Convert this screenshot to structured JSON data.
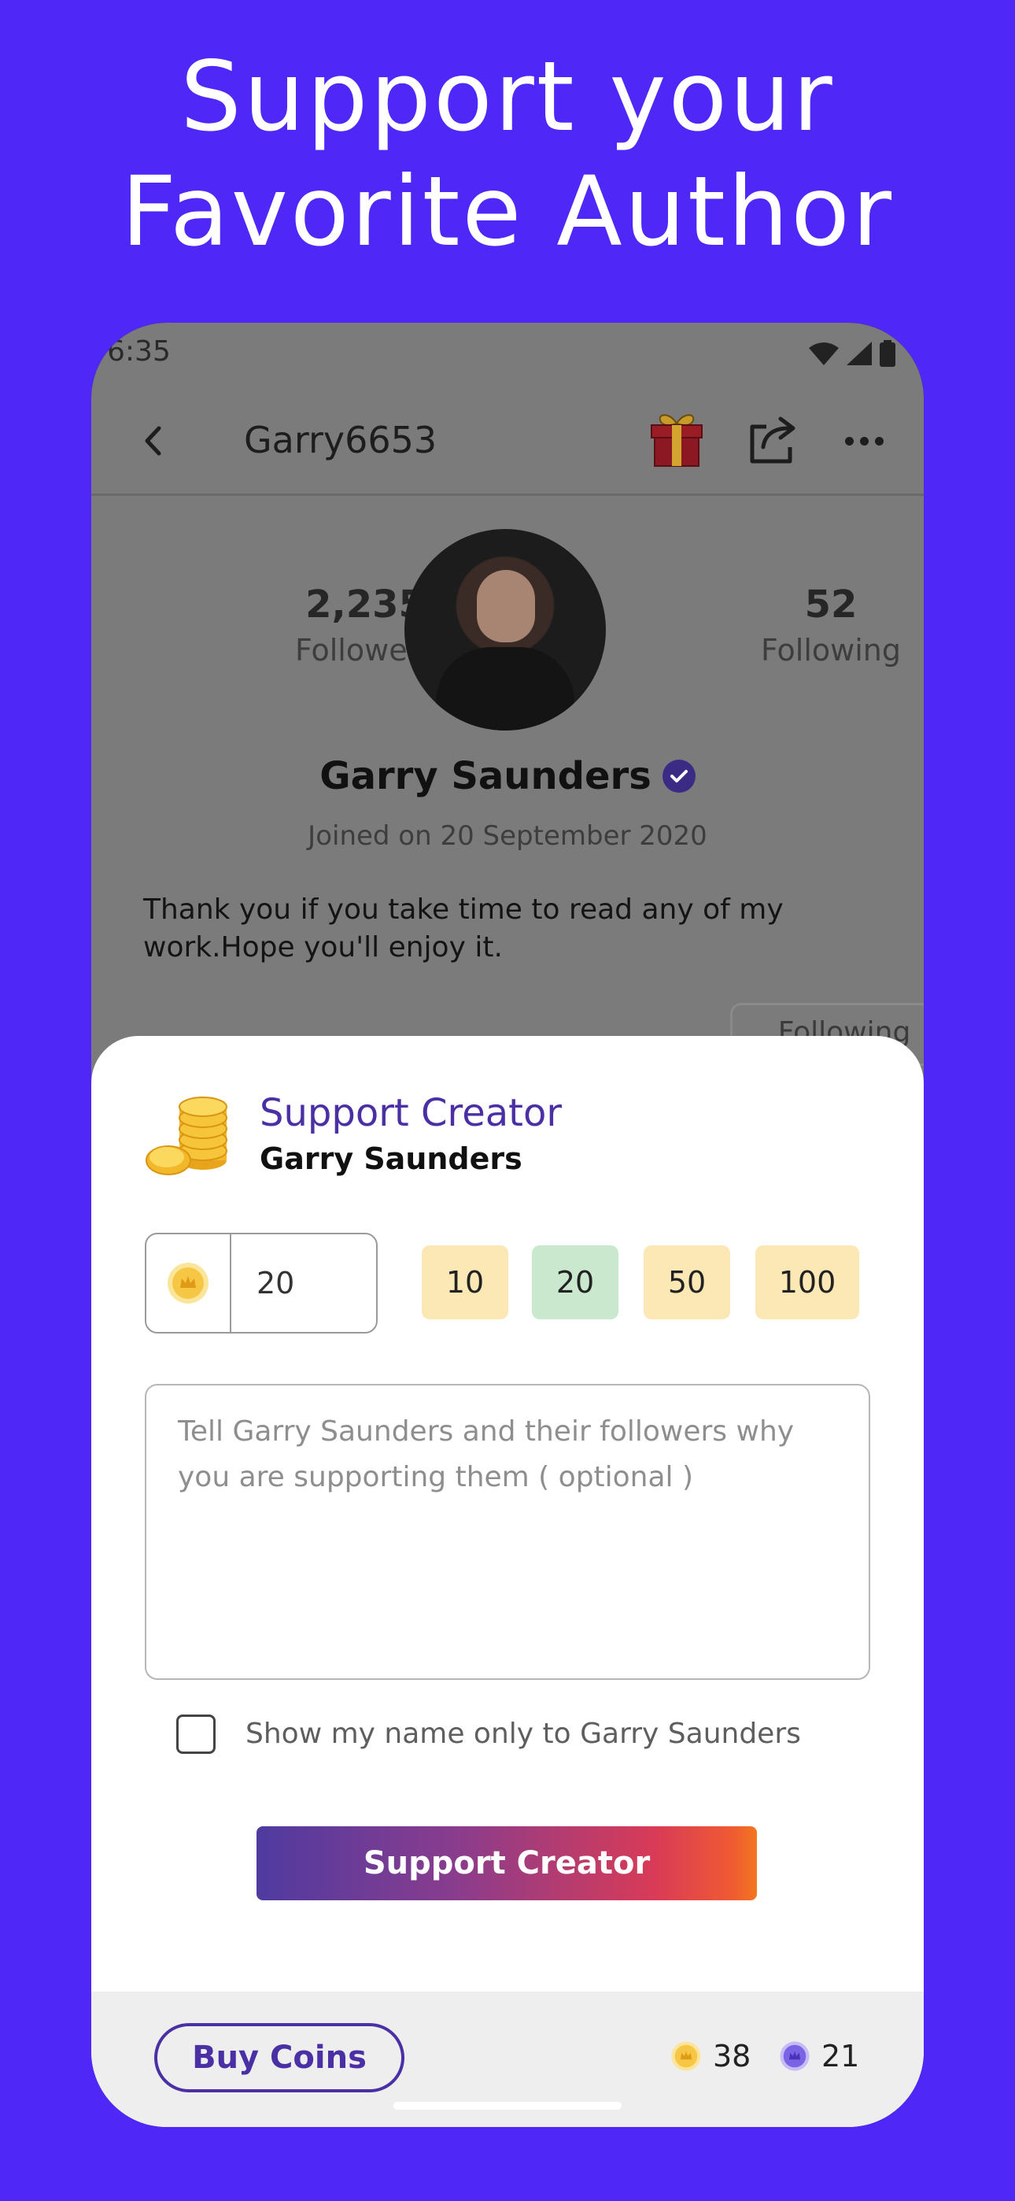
{
  "hero": {
    "line1": "Support your",
    "line2": "Favorite Author"
  },
  "status_bar": {
    "time": "6:35"
  },
  "navbar": {
    "username": "Garry6653"
  },
  "profile": {
    "followers_count": "2,235",
    "followers_label": "Followers",
    "following_count": "52",
    "following_label": "Following",
    "name": "Garry Saunders",
    "joined": "Joined on 20 September 2020",
    "bio": "Thank you if you take time to read any of my work.Hope you'll enjoy it.",
    "following_button": "Following"
  },
  "sheet": {
    "title": "Support Creator",
    "creator_name": "Garry Saunders",
    "amount_value": "20",
    "chips": [
      "10",
      "20",
      "50",
      "100"
    ],
    "selected_chip": "20",
    "message_placeholder": "Tell Garry Saunders and their followers why you are supporting them  ( optional )",
    "checkbox_label": "Show my name only to Garry Saunders",
    "checkbox_checked": false,
    "support_button": "Support Creator",
    "buy_coins": "Buy Coins",
    "gold_balance": "38",
    "purple_balance": "21"
  },
  "colors": {
    "background": "#4f27f6",
    "accent": "#4a2fa5",
    "chip_default": "#fbe8b5",
    "chip_selected": "#c9e8cd",
    "gold_coin": "#f6c744",
    "purple_coin": "#7b63e6"
  },
  "icons": {
    "back": "chevron-left-icon",
    "gift": "gift-icon",
    "share": "share-icon",
    "more": "more-horizontal-icon",
    "verified": "verified-badge-icon",
    "coins": "coin-stack-icon",
    "coin": "gold-coin-icon",
    "purple_coin": "purple-coin-icon"
  }
}
